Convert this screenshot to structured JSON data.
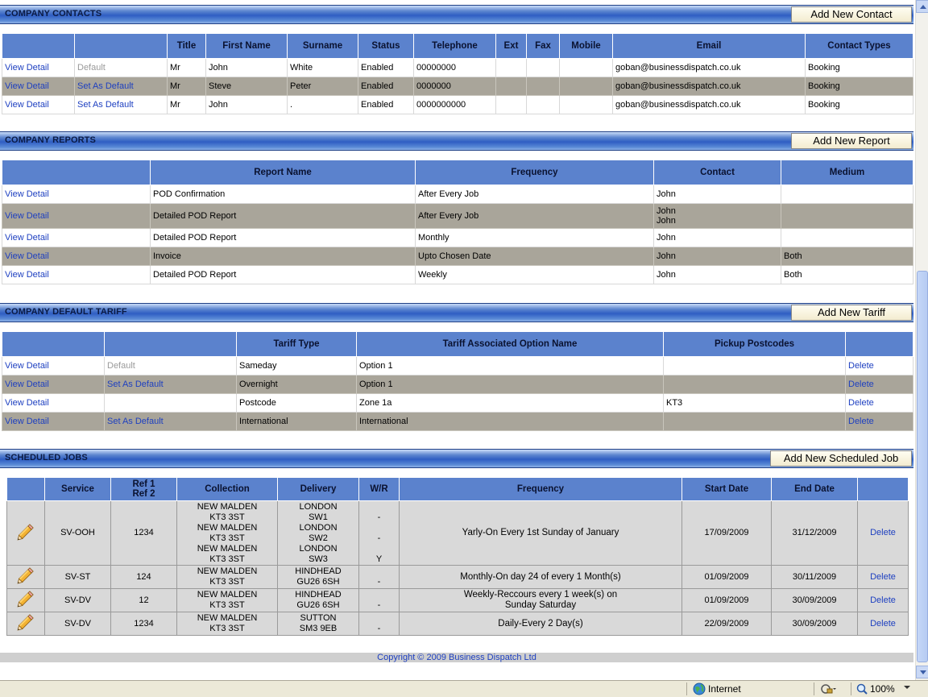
{
  "contacts": {
    "title": "COMPANY CONTACTS",
    "add_label": "Add New Contact",
    "headers": [
      "",
      "",
      "Title",
      "First Name",
      "Surname",
      "Status",
      "Telephone",
      "Ext",
      "Fax",
      "Mobile",
      "Email",
      "Contact Types"
    ],
    "rows": [
      {
        "view": "View Detail",
        "def": "Default",
        "def_state": "default",
        "title": "Mr",
        "first": "John",
        "surname": "White",
        "status": "Enabled",
        "tel": "00000000",
        "ext": "",
        "fax": "",
        "mobile": "",
        "email": "goban@businessdispatch.co.uk",
        "types": "Booking"
      },
      {
        "view": "View Detail",
        "def": "Set As Default",
        "def_state": "link",
        "title": "Mr",
        "first": "Steve",
        "surname": "Peter",
        "status": "Enabled",
        "tel": "0000000",
        "ext": "",
        "fax": "",
        "mobile": "",
        "email": "goban@businessdispatch.co.uk",
        "types": "Booking"
      },
      {
        "view": "View Detail",
        "def": "Set As Default",
        "def_state": "link",
        "title": "Mr",
        "first": "John",
        "surname": ".",
        "status": "Enabled",
        "tel": "0000000000",
        "ext": "",
        "fax": "",
        "mobile": "",
        "email": "goban@businessdispatch.co.uk",
        "types": "Booking"
      }
    ]
  },
  "reports": {
    "title": "COMPANY REPORTS",
    "add_label": "Add New Report",
    "headers": [
      "",
      "Report Name",
      "Frequency",
      "Contact",
      "Medium"
    ],
    "rows": [
      {
        "view": "View Detail",
        "name": "POD Confirmation",
        "freq": "After Every Job",
        "contact": "John",
        "contact2": "",
        "medium": ""
      },
      {
        "view": "View Detail",
        "name": "Detailed POD Report",
        "freq": "After Every Job",
        "contact": "John",
        "contact2": "John",
        "medium": ""
      },
      {
        "view": "View Detail",
        "name": "Detailed POD Report",
        "freq": "Monthly",
        "contact": "John",
        "contact2": "",
        "medium": ""
      },
      {
        "view": "View Detail",
        "name": "Invoice",
        "freq": "Upto Chosen Date",
        "contact": "John",
        "contact2": "",
        "medium": "Both"
      },
      {
        "view": "View Detail",
        "name": "Detailed POD Report",
        "freq": "Weekly",
        "contact": "John",
        "contact2": "",
        "medium": "Both"
      }
    ]
  },
  "tariffs": {
    "title": "COMPANY DEFAULT TARIFF",
    "add_label": "Add New Tariff",
    "headers": [
      "",
      "",
      "Tariff Type",
      "Tariff Associated Option Name",
      "Pickup Postcodes",
      ""
    ],
    "rows": [
      {
        "view": "View Detail",
        "def": "Default",
        "def_state": "default",
        "type": "Sameday",
        "option": "Option 1",
        "postcodes": "",
        "delete": "Delete"
      },
      {
        "view": "View Detail",
        "def": "Set As Default",
        "def_state": "link",
        "type": "Overnight",
        "option": "Option 1",
        "postcodes": "",
        "delete": "Delete"
      },
      {
        "view": "View Detail",
        "def": "",
        "def_state": "none",
        "type": "Postcode",
        "option": "Zone 1a",
        "postcodes": "KT3",
        "delete": "Delete"
      },
      {
        "view": "View Detail",
        "def": "Set As Default",
        "def_state": "link",
        "type": "International",
        "option": "International",
        "postcodes": "",
        "delete": "Delete"
      }
    ]
  },
  "jobs": {
    "title": "SCHEDULED JOBS",
    "add_label": "Add New Scheduled Job",
    "headers": {
      "edit": "",
      "service": "Service",
      "ref1": "Ref 1",
      "ref2": "Ref 2",
      "collection": "Collection",
      "delivery": "Delivery",
      "wr": "W/R",
      "frequency": "Frequency",
      "start": "Start Date",
      "end": "End Date",
      "action": ""
    },
    "rows": [
      {
        "service": "SV-OOH",
        "ref": "1234",
        "collection": [
          "NEW MALDEN",
          "KT3 3ST",
          "NEW MALDEN",
          "KT3 3ST",
          "NEW MALDEN",
          "KT3 3ST"
        ],
        "delivery": [
          "LONDON",
          "SW1",
          "LONDON",
          "SW2",
          "LONDON",
          "SW3"
        ],
        "wr": [
          "-",
          "-",
          "Y"
        ],
        "frequency": [
          "Yarly-On Every 1st Sunday of January"
        ],
        "start": "17/09/2009",
        "end": "31/12/2009",
        "delete": "Delete"
      },
      {
        "service": "SV-ST",
        "ref": "124",
        "collection": [
          "NEW MALDEN",
          "KT3 3ST"
        ],
        "delivery": [
          "HINDHEAD",
          "GU26 6SH"
        ],
        "wr": [
          "-"
        ],
        "frequency": [
          "Monthly-On day 24 of every 1 Month(s)"
        ],
        "start": "01/09/2009",
        "end": "30/11/2009",
        "delete": "Delete"
      },
      {
        "service": "SV-DV",
        "ref": "12",
        "collection": [
          "NEW MALDEN",
          "KT3 3ST"
        ],
        "delivery": [
          "HINDHEAD",
          "GU26 6SH"
        ],
        "wr": [
          "-"
        ],
        "frequency": [
          "Weekly-Reccours every 1 week(s) on",
          "Sunday Saturday"
        ],
        "start": "01/09/2009",
        "end": "30/09/2009",
        "delete": "Delete"
      },
      {
        "service": "SV-DV",
        "ref": "1234",
        "collection": [
          "NEW MALDEN",
          "KT3 3ST"
        ],
        "delivery": [
          "SUTTON",
          "SM3 9EB"
        ],
        "wr": [
          "-"
        ],
        "frequency": [
          "Daily-Every 2 Day(s)"
        ],
        "start": "22/09/2009",
        "end": "30/09/2009",
        "delete": "Delete"
      }
    ]
  },
  "footer": {
    "copyright": "Copyright © 2009 Business Dispatch Ltd"
  },
  "statusbar": {
    "zone": "Internet",
    "zoom": "100%",
    "zone_icon": "globe-icon",
    "zoom_icon": "magnifier-icon"
  },
  "colors": {
    "header_blue": "#2f5ec3",
    "column_header": "#5b82cd",
    "alt_row": "#a9a59a",
    "link": "#1d3fc0",
    "job_row": "#d9d9d9"
  }
}
